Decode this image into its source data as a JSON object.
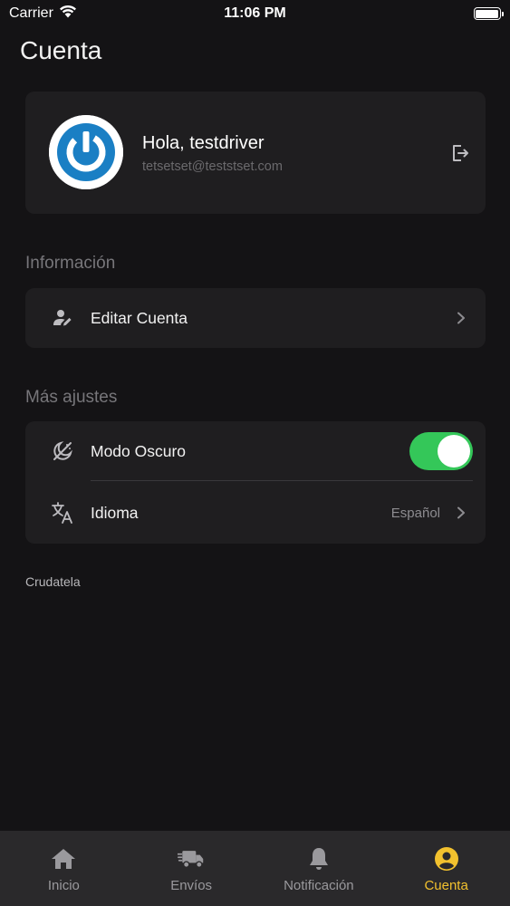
{
  "status_bar": {
    "carrier": "Carrier",
    "time": "11:06 PM"
  },
  "page": {
    "title": "Cuenta"
  },
  "profile": {
    "greeting": "Hola, testdriver",
    "email": "tetsetset@teststset.com"
  },
  "sections": {
    "info_title": "Información",
    "more_title": "Más ajustes"
  },
  "items": {
    "edit_account": "Editar Cuenta",
    "dark_mode": "Modo Oscuro",
    "dark_mode_on": true,
    "language": "Idioma",
    "language_value": "Español"
  },
  "footer_note": "Crudatela",
  "tabs": [
    {
      "label": "Inicio",
      "icon": "home-icon"
    },
    {
      "label": "Envíos",
      "icon": "truck-icon"
    },
    {
      "label": "Notificación",
      "icon": "bell-icon"
    },
    {
      "label": "Cuenta",
      "icon": "user-circle-icon",
      "active": true
    }
  ],
  "colors": {
    "background": "#141315",
    "card": "#1f1e20",
    "toggle_on": "#34c759",
    "tab_active": "#f2c12e",
    "avatar_brand": "#1a7fc4"
  }
}
